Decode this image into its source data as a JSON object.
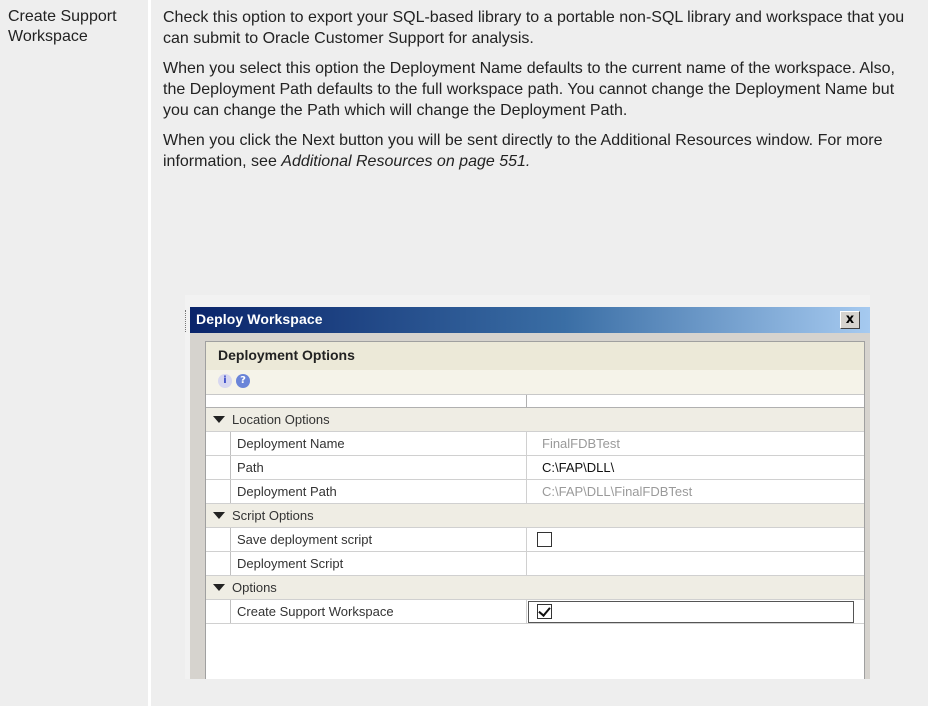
{
  "term": "Create Support Workspace",
  "paragraphs": {
    "p1": "Check this option to export your SQL-based library to a portable non-SQL library and workspace that you can submit to Oracle Customer Support for analysis.",
    "p2": "When you select this option the Deployment Name defaults to the current name of the workspace. Also, the Deployment Path defaults to the full workspace path. You cannot change the Deployment Name but you can change the Path which will change the Deployment Path.",
    "p3_text": "When you click the Next button you will be sent directly to the Additional Resources window. For more information, see ",
    "p3_link": "Additional Resources on page 551."
  },
  "dialog": {
    "title": "Deploy Workspace",
    "close_glyph": "x",
    "panel_title": "Deployment Options",
    "toolbar_icons": [
      "info-icon",
      "help-icon"
    ],
    "sections": [
      {
        "name": "Location Options",
        "rows": [
          {
            "label": "Deployment Name",
            "value": "FinalFDBTest",
            "style": "muted"
          },
          {
            "label": "Path",
            "value": "C:\\FAP\\DLL\\",
            "style": "bold"
          },
          {
            "label": "Deployment Path",
            "value": "C:\\FAP\\DLL\\FinalFDBTest",
            "style": "muted"
          }
        ]
      },
      {
        "name": "Script Options",
        "rows": [
          {
            "label": "Save deployment script",
            "checkbox": false
          },
          {
            "label": "Deployment Script",
            "value": ""
          }
        ]
      },
      {
        "name": "Options",
        "rows": [
          {
            "label": "Create Support Workspace",
            "checkbox": true,
            "selected": true
          }
        ]
      }
    ]
  }
}
